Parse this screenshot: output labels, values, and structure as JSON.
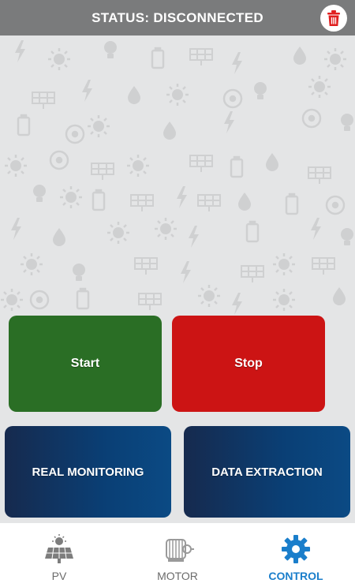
{
  "header": {
    "title": "STATUS: DISCONNECTED",
    "delete_icon": "trash-icon"
  },
  "controls": {
    "start_label": "Start",
    "stop_label": "Stop",
    "monitoring_label": "REAL MONITORING",
    "extraction_label": "DATA EXTRACTION"
  },
  "nav": {
    "items": [
      {
        "label": "PV",
        "icon": "solar-panel-icon",
        "active": false
      },
      {
        "label": "MOTOR",
        "icon": "motor-icon",
        "active": false
      },
      {
        "label": "CONTROL",
        "icon": "gear-icon",
        "active": true
      }
    ]
  },
  "colors": {
    "header_bg": "#7a7b7c",
    "start": "#2a6e25",
    "stop": "#cc1414",
    "navy": "#0a3f75",
    "active_nav": "#1a7ecb",
    "background": "#e4e5e6"
  }
}
